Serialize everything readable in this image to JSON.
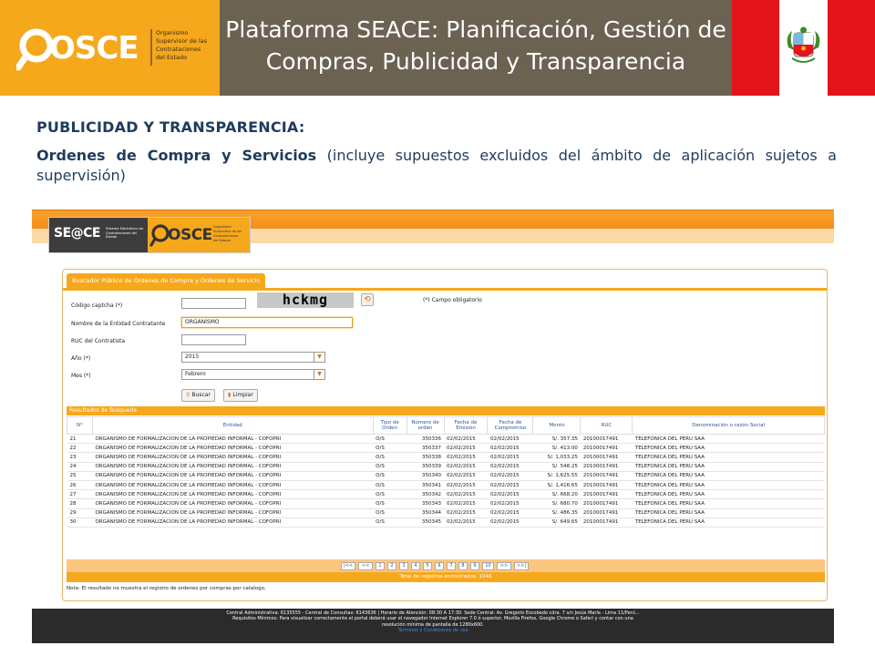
{
  "slide": {
    "title": "Plataforma SEACE: Planificación, Gestión de Compras, Publicidad y Transparencia",
    "logo_text": "OSCE",
    "logo_subtext": "Organismo Supervisor de las Contrataciones del Estado",
    "heading": "PUBLICIDAD Y TRANSPARENCIA:",
    "subheading_bold": "Ordenes de Compra y Servicios",
    "subheading_rest": " (incluye supuestos excluidos del ámbito de aplicación sujetos a supervisión)"
  },
  "app": {
    "logo_seace": "SE@CE",
    "logo_seace_sub": "Sistema Electrónico de Contrataciones del Estado",
    "logo_osce": "OSCE",
    "tab_label": "Buscador Público de Órdenes de Compra y Órdenes de Servicio",
    "form": {
      "captcha_label": "Código captcha (*)",
      "captcha_value": "",
      "captcha_image_text": "hckmg",
      "required_note": "(*) Campo obligatorio",
      "entidad_label": "Nombre de la Entidad Contratante",
      "entidad_value": "ORGANISMO",
      "ruc_label": "RUC del Contratista",
      "ruc_value": "",
      "anio_label": "Año (*)",
      "anio_value": "2015",
      "mes_label": "Mes (*)",
      "mes_value": "Febrero",
      "buscar_label": "Buscar",
      "limpiar_label": "Limpiar"
    },
    "results": {
      "title": "Resultados de Búsqueda",
      "headers": [
        "N°",
        "Entidad",
        "Tipo de Orden",
        "Número de orden",
        "Fecha de Emisión",
        "Fecha de Compromiso",
        "Monto",
        "RUC",
        "Denominación o razón Social"
      ],
      "rows": [
        [
          "21",
          "ORGANISMO DE FORMALIZACION DE LA PROPIEDAD INFORMAL - COFOPRI",
          "O/S",
          "350336",
          "02/02/2015",
          "02/02/2015",
          "S/. 357.35",
          "20100017491",
          "TELEFONICA DEL PERU SAA"
        ],
        [
          "22",
          "ORGANISMO DE FORMALIZACION DE LA PROPIEDAD INFORMAL - COFOPRI",
          "O/S",
          "350337",
          "02/02/2015",
          "02/02/2015",
          "S/. 413.00",
          "20100017491",
          "TELEFONICA DEL PERU SAA"
        ],
        [
          "23",
          "ORGANISMO DE FORMALIZACION DE LA PROPIEDAD INFORMAL - COFOPRI",
          "O/S",
          "350338",
          "02/02/2015",
          "02/02/2015",
          "S/. 1,033.25",
          "20100017491",
          "TELEFONICA DEL PERU SAA"
        ],
        [
          "24",
          "ORGANISMO DE FORMALIZACION DE LA PROPIEDAD INFORMAL - COFOPRI",
          "O/S",
          "350339",
          "02/02/2015",
          "02/02/2015",
          "S/. 548.25",
          "20100017491",
          "TELEFONICA DEL PERU SAA"
        ],
        [
          "25",
          "ORGANISMO DE FORMALIZACION DE LA PROPIEDAD INFORMAL - COFOPRI",
          "O/S",
          "350340",
          "02/02/2015",
          "02/02/2015",
          "S/. 1,625.55",
          "20100017491",
          "TELEFONICA DEL PERU SAA"
        ],
        [
          "26",
          "ORGANISMO DE FORMALIZACION DE LA PROPIEDAD INFORMAL - COFOPRI",
          "O/S",
          "350341",
          "02/02/2015",
          "02/02/2015",
          "S/. 1,416.65",
          "20100017491",
          "TELEFONICA DEL PERU SAA"
        ],
        [
          "27",
          "ORGANISMO DE FORMALIZACION DE LA PROPIEDAD INFORMAL - COFOPRI",
          "O/S",
          "350342",
          "02/02/2015",
          "02/02/2015",
          "S/. 668.20",
          "20100017491",
          "TELEFONICA DEL PERU SAA"
        ],
        [
          "28",
          "ORGANISMO DE FORMALIZACION DE LA PROPIEDAD INFORMAL - COFOPRI",
          "O/S",
          "350343",
          "02/02/2015",
          "02/02/2015",
          "S/. 680.70",
          "20100017491",
          "TELEFONICA DEL PERU SAA"
        ],
        [
          "29",
          "ORGANISMO DE FORMALIZACION DE LA PROPIEDAD INFORMAL - COFOPRI",
          "O/S",
          "350344",
          "02/02/2015",
          "02/02/2015",
          "S/. 486.35",
          "20100017491",
          "TELEFONICA DEL PERU SAA"
        ],
        [
          "30",
          "ORGANISMO DE FORMALIZACION DE LA PROPIEDAD INFORMAL - COFOPRI",
          "O/S",
          "350345",
          "02/02/2015",
          "02/02/2015",
          "S/. 649.65",
          "20100017491",
          "TELEFONICA DEL PERU SAA"
        ]
      ],
      "pager": {
        "first": "|<<",
        "prev": "<<",
        "pages": [
          "1",
          "2",
          "3",
          "4",
          "5",
          "6",
          "7",
          "8",
          "9",
          "10"
        ],
        "next": ">>",
        "last": ">>|"
      },
      "total": "Total de registros encontrados: 1048",
      "note": "Nota: El resultado no muestra el registro de ordenes por compras por catalogo."
    },
    "footer": {
      "line1": "Central Administrativa: 6135555 - Central de Consultas: 6143636 | Horario de Atención: 08:30 A 17:30. Sede Central: Av. Gregorio Escobedo cdra. 7 s/n Jesús María - Lima 11/Perú...",
      "line2": "Requisitos Mínimos: Para visualizar correctamente el portal deberá usar el navegador Internet Explorer 7.0 ó superior, Mozilla Firefox, Google Chrome o Safari y contar con una",
      "line3": "resolución mínima de pantalla de 1280x600.",
      "link": "Términos y Condiciones de uso"
    }
  },
  "colors": {
    "osce_orange": "#f6a81c",
    "title_bg": "#6b6252",
    "flag_red": "#e4141c",
    "heading_text": "#1f3c5c",
    "table_header_text": "#2a55a0"
  }
}
